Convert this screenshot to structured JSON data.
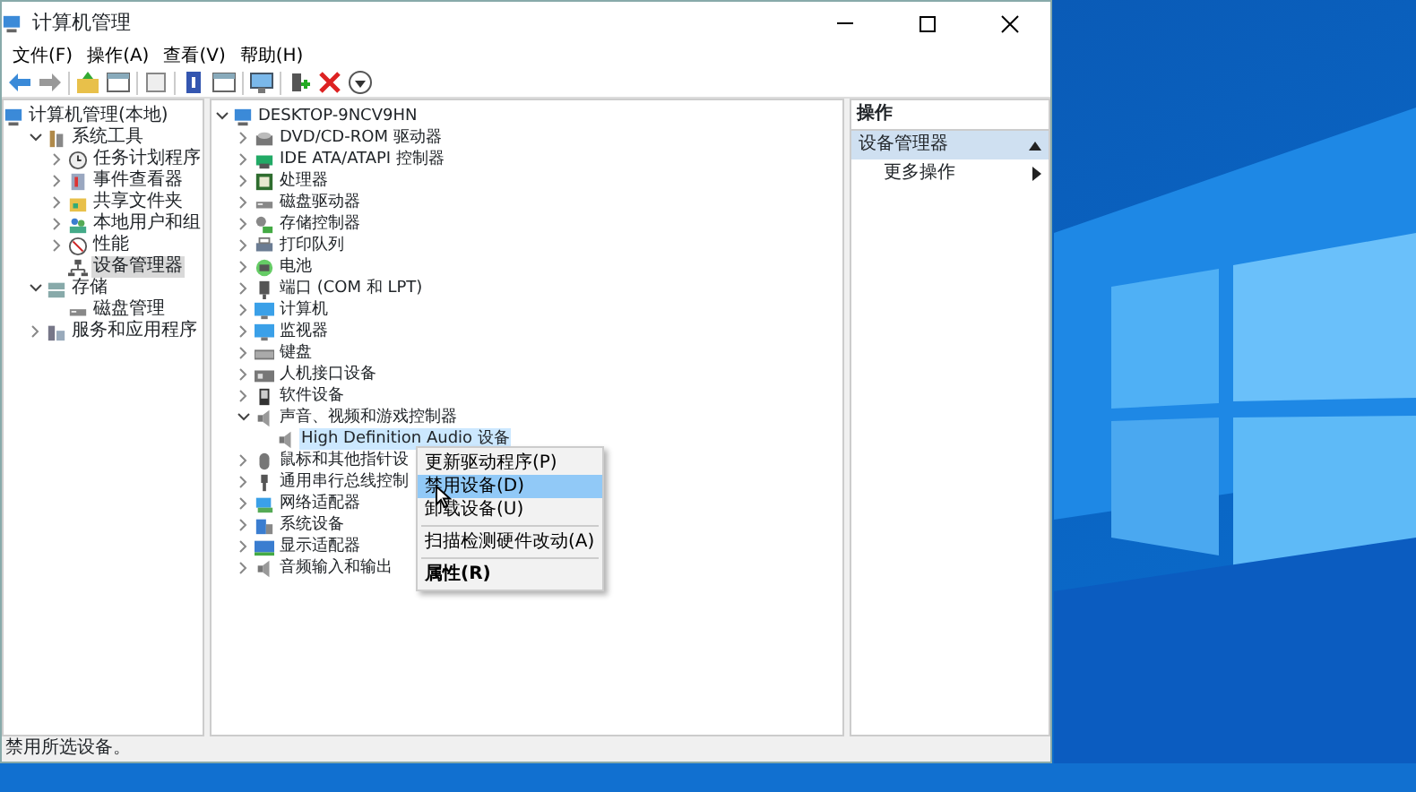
{
  "window": {
    "title": "计算机管理"
  },
  "menu": [
    "文件(F)",
    "操作(A)",
    "查看(V)",
    "帮助(H)"
  ],
  "nav_tree": {
    "label": "计算机管理(本地)",
    "selected": false,
    "children": [
      {
        "label": "系统工具",
        "expanded": true,
        "selected": false,
        "children": [
          {
            "label": "任务计划程序",
            "expanded": false,
            "selected": false
          },
          {
            "label": "事件查看器",
            "expanded": false,
            "selected": false
          },
          {
            "label": "共享文件夹",
            "expanded": false,
            "selected": false
          },
          {
            "label": "本地用户和组",
            "expanded": false,
            "selected": false
          },
          {
            "label": "性能",
            "expanded": false,
            "selected": false
          },
          {
            "label": "设备管理器",
            "selected": true
          }
        ]
      },
      {
        "label": "存储",
        "expanded": true,
        "selected": false,
        "children": [
          {
            "label": "磁盘管理",
            "selected": false
          }
        ]
      },
      {
        "label": "服务和应用程序",
        "expanded": false,
        "selected": false
      }
    ]
  },
  "device_tree": {
    "label": "DESKTOP-9NCV9HN",
    "expanded": true,
    "selected": false,
    "children": [
      {
        "label": "DVD/CD-ROM 驱动器",
        "expanded": false,
        "selected": false
      },
      {
        "label": "IDE ATA/ATAPI 控制器",
        "expanded": false,
        "selected": false
      },
      {
        "label": "处理器",
        "expanded": false,
        "selected": false
      },
      {
        "label": "磁盘驱动器",
        "expanded": false,
        "selected": false
      },
      {
        "label": "存储控制器",
        "expanded": false,
        "selected": false
      },
      {
        "label": "打印队列",
        "expanded": false,
        "selected": false
      },
      {
        "label": "电池",
        "expanded": false,
        "selected": false
      },
      {
        "label": "端口 (COM 和 LPT)",
        "expanded": false,
        "selected": false
      },
      {
        "label": "计算机",
        "expanded": false,
        "selected": false
      },
      {
        "label": "监视器",
        "expanded": false,
        "selected": false
      },
      {
        "label": "键盘",
        "expanded": false,
        "selected": false
      },
      {
        "label": "人机接口设备",
        "expanded": false,
        "selected": false
      },
      {
        "label": "软件设备",
        "expanded": false,
        "selected": false
      },
      {
        "label": "声音、视频和游戏控制器",
        "expanded": true,
        "selected": false,
        "children": [
          {
            "label": "High Definition Audio 设备",
            "selected": true
          }
        ]
      },
      {
        "label": "鼠标和其他指针设",
        "expanded": false,
        "selected": false
      },
      {
        "label": "通用串行总线控制",
        "expanded": false,
        "selected": false
      },
      {
        "label": "网络适配器",
        "expanded": false,
        "selected": false
      },
      {
        "label": "系统设备",
        "expanded": false,
        "selected": false
      },
      {
        "label": "显示适配器",
        "expanded": false,
        "selected": false
      },
      {
        "label": "音频输入和输出",
        "expanded": false,
        "selected": false
      }
    ]
  },
  "actions": {
    "header": "操作",
    "sections": [
      {
        "title": "设备管理器",
        "expanded": true,
        "items": [
          {
            "label": "更多操作"
          }
        ]
      }
    ]
  },
  "context_menu": [
    {
      "kind": "item",
      "label": "更新驱动程序(P)",
      "selected": false,
      "default": false
    },
    {
      "kind": "item",
      "label": "禁用设备(D)",
      "selected": true,
      "default": false
    },
    {
      "kind": "item",
      "label": "卸载设备(U)",
      "selected": false,
      "default": false
    },
    {
      "kind": "separator"
    },
    {
      "kind": "item",
      "label": "扫描检测硬件改动(A)",
      "selected": false,
      "default": false
    },
    {
      "kind": "separator"
    },
    {
      "kind": "item",
      "label": "属性(R)",
      "selected": false,
      "default": true
    }
  ],
  "status_bar": "禁用所选设备。"
}
